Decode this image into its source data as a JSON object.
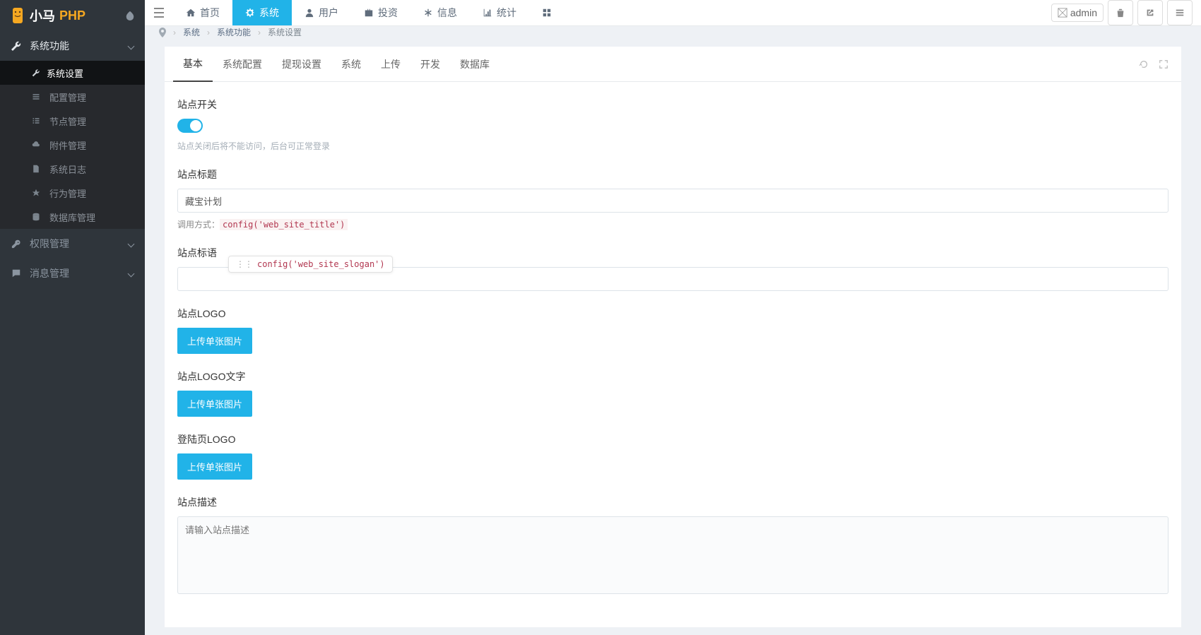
{
  "brand": {
    "xm": "小马",
    "php": "PHP"
  },
  "sidebar": {
    "section1": {
      "label": "系统功能"
    },
    "items": [
      {
        "label": "系统设置"
      },
      {
        "label": "配置管理"
      },
      {
        "label": "节点管理"
      },
      {
        "label": "附件管理"
      },
      {
        "label": "系统日志"
      },
      {
        "label": "行为管理"
      },
      {
        "label": "数据库管理"
      }
    ],
    "section2": {
      "label": "权限管理"
    },
    "section3": {
      "label": "消息管理"
    }
  },
  "topnav": [
    {
      "label": "首页"
    },
    {
      "label": "系统"
    },
    {
      "label": "用户"
    },
    {
      "label": "投资"
    },
    {
      "label": "信息"
    },
    {
      "label": "统计"
    }
  ],
  "admin_label": "admin",
  "breadcrumb": {
    "a": "系统",
    "b": "系统功能",
    "c": "系统设置"
  },
  "tabs": [
    "基本",
    "系统配置",
    "提现设置",
    "系统",
    "上传",
    "开发",
    "数据库"
  ],
  "form": {
    "site_switch": {
      "label": "站点开关",
      "help": "站点关闭后将不能访问，后台可正常登录"
    },
    "site_title": {
      "label": "站点标题",
      "value": "藏宝计划",
      "call_prefix": "调用方式：",
      "call_code": "config('web_site_title')"
    },
    "site_slogan": {
      "label": "站点标语",
      "value": "",
      "call_code": "config('web_site_slogan')"
    },
    "site_logo": {
      "label": "站点LOGO",
      "button": "上传单张图片"
    },
    "site_logo_text": {
      "label": "站点LOGO文字",
      "button": "上传单张图片"
    },
    "login_logo": {
      "label": "登陆页LOGO",
      "button": "上传单张图片"
    },
    "site_desc": {
      "label": "站点描述",
      "placeholder": "请输入站点描述"
    }
  }
}
